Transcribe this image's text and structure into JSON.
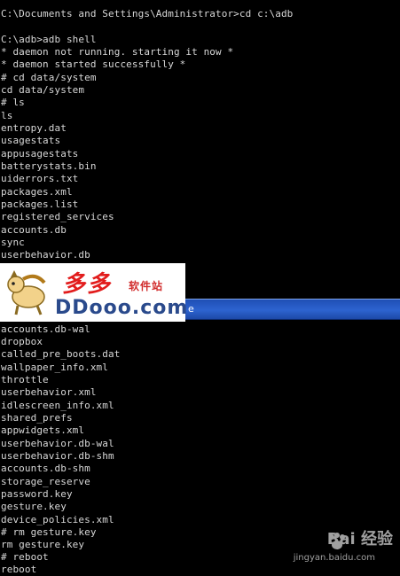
{
  "console": {
    "lines_top": [
      "C:\\Documents and Settings\\Administrator>cd c:\\adb",
      "",
      "C:\\adb>adb shell",
      "* daemon not running. starting it now *",
      "* daemon started successfully *",
      "# cd data/system",
      "cd data/system",
      "# ls",
      "ls",
      "entropy.dat",
      "usagestats",
      "appusagestats",
      "batterystats.bin",
      "uiderrors.txt",
      "packages.xml",
      "packages.list",
      "registered_services",
      "accounts.db",
      "sync",
      "userbehavior.db"
    ],
    "titlebar_text": "e",
    "lines_bottom": [
      "accounts.db-wal",
      "dropbox",
      "called_pre_boots.dat",
      "wallpaper_info.xml",
      "throttle",
      "userbehavior.xml",
      "idlescreen_info.xml",
      "shared_prefs",
      "appwidgets.xml",
      "userbehavior.db-wal",
      "userbehavior.db-shm",
      "accounts.db-shm",
      "storage_reserve",
      "password.key",
      "gesture.key",
      "device_policies.xml",
      "# rm gesture.key",
      "rm gesture.key",
      "# reboot",
      "reboot"
    ]
  },
  "watermark": {
    "logo_cn": "多多",
    "logo_cn_sub": "软件站",
    "logo_en": "DDooo.com"
  },
  "baidu": {
    "mark": "Bai 经验",
    "sub": "jingyan.baidu.com"
  },
  "colors": {
    "console_bg": "#000000",
    "console_text": "#d8d8d8",
    "titlebar": "#2d63d0"
  }
}
